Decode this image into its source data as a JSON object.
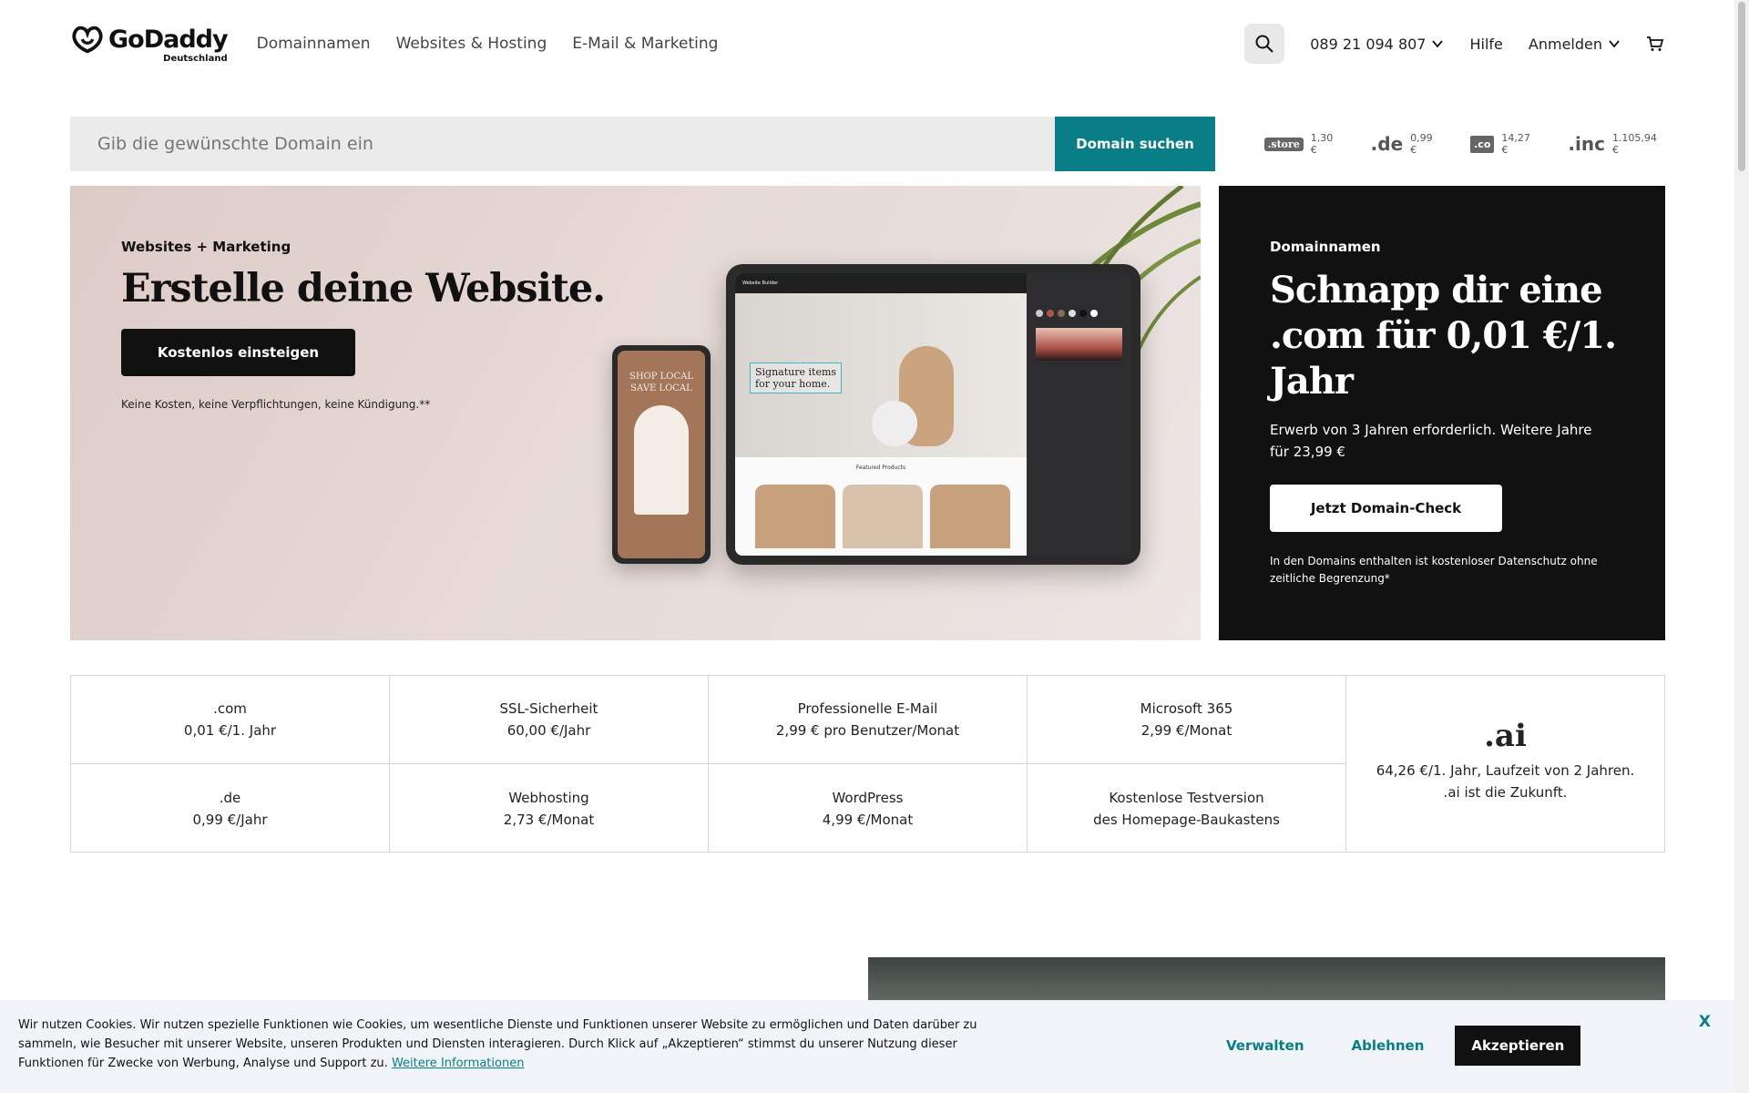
{
  "header": {
    "logo": "GoDaddy",
    "logo_sub": "Deutschland",
    "nav": [
      "Domainnamen",
      "Websites & Hosting",
      "E-Mail & Marketing"
    ],
    "phone": "089 21 094 807",
    "help": "Hilfe",
    "login": "Anmelden"
  },
  "search": {
    "placeholder": "Gib die gewünschte Domain ein",
    "button": "Domain suchen",
    "tlds": [
      {
        "mark": ".store",
        "price": "1,30 €"
      },
      {
        "mark": ".de",
        "price": "0,99 €"
      },
      {
        "mark": ".co",
        "price": "14,27 €"
      },
      {
        "mark": ".inc",
        "price": "1.105,94 €"
      }
    ]
  },
  "hero": {
    "eyebrow": "Websites + Marketing",
    "title": "Erstelle deine Website.",
    "button": "Kostenlos einsteigen",
    "note": "Keine Kosten, keine Verpflichtungen, keine Kündigung.**",
    "mock": {
      "phone_text_1": "SHOP LOCAL",
      "phone_text_2": "SAVE LOCAL",
      "tablet_app": "Website Builder",
      "callout_1": "Signature items",
      "callout_2": "for your home.",
      "products_title": "Featured Products"
    }
  },
  "promo": {
    "eyebrow": "Domainnamen",
    "title": "Schnapp dir eine .com für 0,01 €/1. Jahr",
    "subtitle": "Erwerb von 3 Jahren erforderlich. Weitere Jahre für 23,99 €",
    "button": "Jetzt Domain-Check",
    "note": "In den Domains enthalten ist kostenloser Datenschutz ohne zeitliche Begrenzung*"
  },
  "grid": {
    "cells": [
      {
        "title": ".com",
        "price": "0,01 €/1. Jahr"
      },
      {
        "title": "SSL-Sicherheit",
        "price": "60,00 €/Jahr"
      },
      {
        "title": "Professionelle E-Mail",
        "price": "2,99 € pro Benutzer/Monat"
      },
      {
        "title": "Microsoft 365",
        "price": "2,99 €/Monat"
      },
      {
        "title": ".de",
        "price": "0,99 €/Jahr"
      },
      {
        "title": "Webhosting",
        "price": "2,73 €/Monat"
      },
      {
        "title": "WordPress",
        "price": "4,99 €/Monat"
      },
      {
        "title": "Kostenlose Testversion",
        "price": "des Homepage-Baukastens"
      }
    ],
    "ai": {
      "mark": ".ai",
      "line1": "64,26 €/1. Jahr, Laufzeit von 2 Jahren.",
      "line2": ".ai ist die Zukunft."
    }
  },
  "cookie": {
    "text": "Wir nutzen Cookies. Wir nutzen spezielle Funktionen wie Cookies, um wesentliche Dienste und Funktionen unserer Website zu ermöglichen und Daten darüber zu sammeln, wie Besucher mit unserer Website, unseren Produkten und Diensten interagieren. Durch Klick auf „Akzeptieren“ stimmst du unserer Nutzung dieser Funktionen für Zwecke von Werbung, Analyse und Support zu.",
    "link": "Weitere Informationen",
    "manage": "Verwalten",
    "decline": "Ablehnen",
    "accept": "Akzeptieren",
    "close": "X"
  },
  "colors": {
    "teal": "#097e86",
    "dark": "#111111"
  }
}
